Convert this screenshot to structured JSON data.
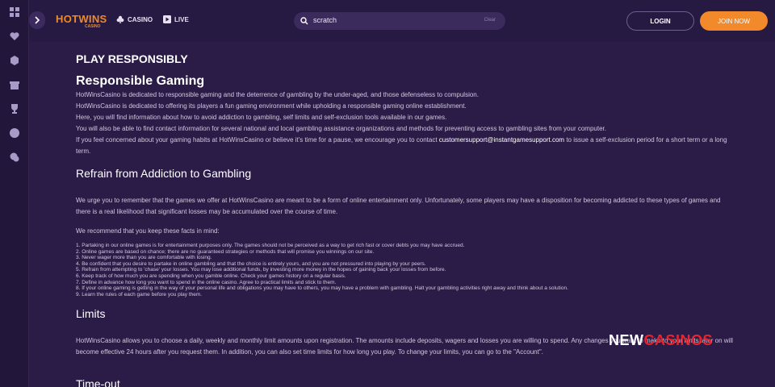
{
  "app": {
    "logo_text": "HOTWINS",
    "logo_sub": "CASINO"
  },
  "nav": {
    "casino": "CASINO",
    "live": "LIVE"
  },
  "search": {
    "value": "scratch",
    "clear_label": "Clear"
  },
  "auth": {
    "login": "LOGIN",
    "join": "JOIN NOW"
  },
  "colors": {
    "background": "#2a1b46",
    "accent": "#f2892a",
    "watermark_red": "#e8232b"
  },
  "sidebar": {
    "icons": [
      "grid-icon",
      "heart-icon",
      "cube-icon",
      "gift-icon",
      "trophy-icon",
      "star-icon",
      "chat-icon"
    ]
  },
  "main": {
    "page_title": "PLAY RESPONSIBLY",
    "responsible": {
      "heading": "Responsible Gaming",
      "lines": [
        "HotWinsCasino is dedicated to responsible gaming and the deterrence of gambling by the under-aged, and those defenseless to compulsion.",
        "HotWinsCasino is dedicated to offering its players a fun gaming environment while upholding a responsible gaming online establishment.",
        "Here, you will find information about how to avoid addiction to gambling, self limits and self-exclusion tools available in our games.",
        "You will also be able to find contact information for several national and local gambling assistance organizations and methods for preventing access to gambling sites from your computer."
      ],
      "contact_pre": "If you feel concerned about your gaming habits at HotWinsCasino or believe it's time for a pause, we encourage you to contact ",
      "contact_email": "customersupport@instantgamesupport.com",
      "contact_post": " to issue a self-exclusion period for a short term or a long term."
    },
    "addiction": {
      "heading": "Refrain from Addiction to Gambling",
      "para": "We urge you to remember that the games we offer at HotWinsCasino are meant to be a form of online entertainment only. Unfortunately, some players may have a disposition for becoming addicted to these types of games and there is a real likelihood that significant losses may be accumulated over the course of time.",
      "intro": "We recommend that you keep these facts in mind:",
      "facts": [
        "1. Partaking in our online games is for entertainment purposes only. The games should not be perceived as a way to get rich fast or cover debts you may have accrued.",
        "2. Online games are based on chance; there are no guaranteed strategies or methods that will promise you winnings on our site.",
        "3. Never wager more than you are comfortable with losing.",
        "4. Be confident that you desire to partake in online gambling and that the choice is entirely yours, and you are not pressured into playing by your peers.",
        "5. Refrain from attempting to 'chase' your losses. You may lose additional funds, by investing more money in the hopes of gaining back your losses from before.",
        "6. Keep track of how much you are spending when you gamble online. Check your games history on a regular basis.",
        "7. Define in advance how long you want to spend in the online casino. Agree to practical limits and stick to them.",
        "8. If your online gaming is getting in the way of your personal life and obligations you may have to others, you may have a problem with gambling. Halt your gambling activities right away and think about a solution.",
        "9. Learn the rules of each game before you play them."
      ]
    },
    "limits": {
      "heading": "Limits",
      "para": "HotWinsCasino allows you to choose a daily, weekly and monthly limit amounts upon registration. The amounts include deposits, wagers and losses you are willing to spend. Any changes you want to make to your limits later on will become effective 24 hours after you request them. In addition, you can also set time limits for how long you play. To change your limits, you can go to the \"Account\"."
    },
    "timeout": {
      "heading": "Time-out"
    }
  },
  "watermark": {
    "part1": "NEW",
    "part2": "CASINOS"
  }
}
